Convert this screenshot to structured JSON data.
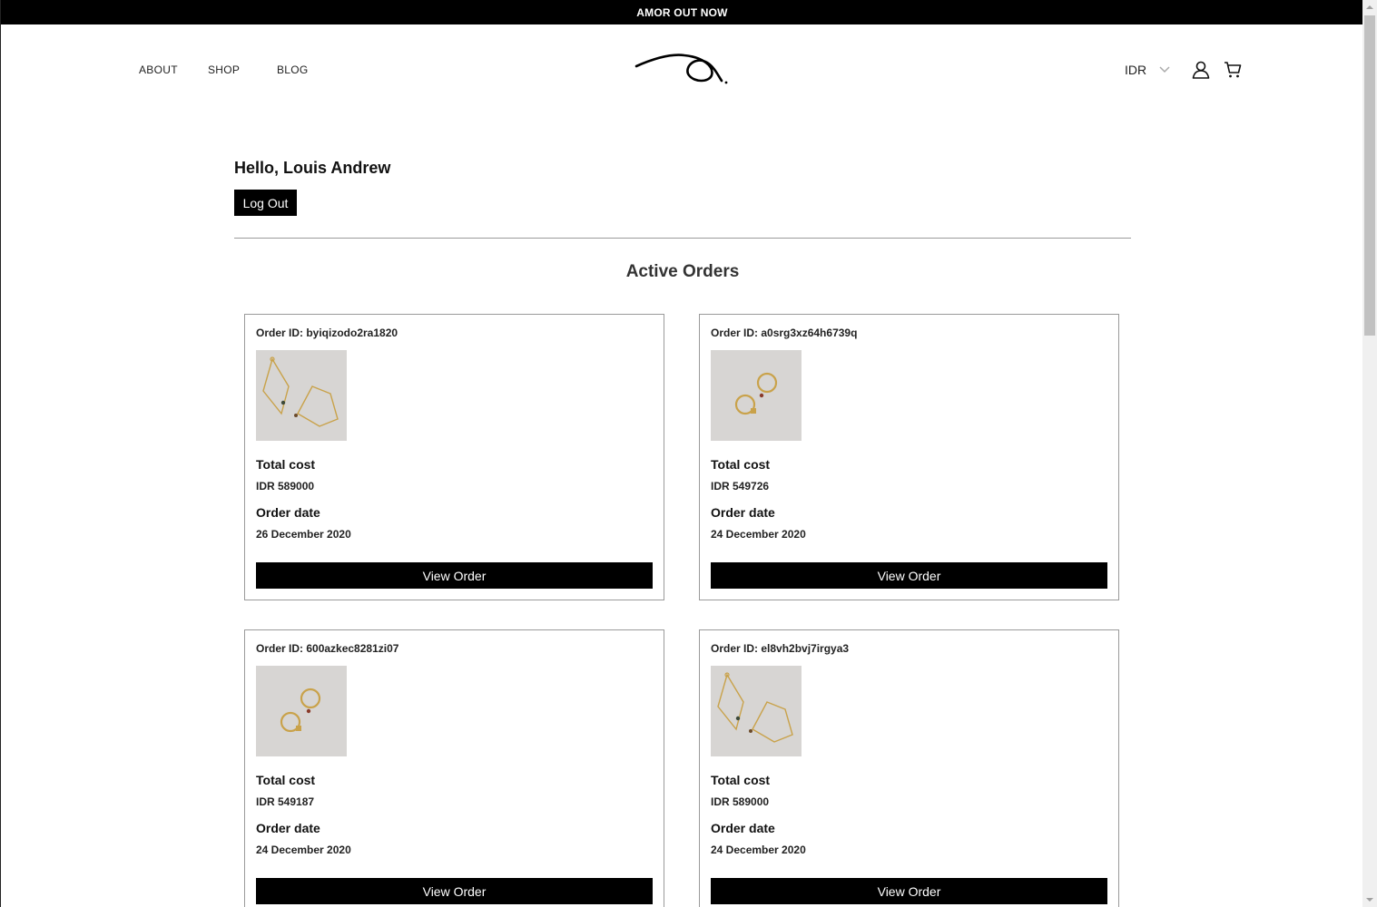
{
  "announcement": "AMOR OUT NOW",
  "nav": {
    "about": "ABOUT",
    "shop": "SHOP",
    "blog": "BLOG"
  },
  "header": {
    "currency": "IDR",
    "logo_icon": "signature-logo-icon",
    "user_icon": "user-icon",
    "cart_icon": "cart-icon"
  },
  "account": {
    "greeting": "Hello, Louis Andrew",
    "logout_label": "Log Out"
  },
  "orders_section": {
    "title": "Active Orders"
  },
  "orders": [
    {
      "id_text": "Order ID: byiqizodo2ra1820",
      "product": "bracelets",
      "cost_label": "Total cost",
      "cost": "IDR 589000",
      "date_label": "Order date",
      "date": "26 December 2020",
      "button": "View Order"
    },
    {
      "id_text": "Order ID: a0srg3xz64h6739q",
      "product": "rings",
      "cost_label": "Total cost",
      "cost": "IDR 549726",
      "date_label": "Order date",
      "date": "24 December 2020",
      "button": "View Order"
    },
    {
      "id_text": "Order ID: 600azkec8281zi07",
      "product": "rings",
      "cost_label": "Total cost",
      "cost": "IDR 549187",
      "date_label": "Order date",
      "date": "24 December 2020",
      "button": "View Order"
    },
    {
      "id_text": "Order ID: el8vh2bvj7irgya3",
      "product": "bracelets",
      "cost_label": "Total cost",
      "cost": "IDR 589000",
      "date_label": "Order date",
      "date": "24 December 2020",
      "button": "View Order"
    }
  ],
  "colors": {
    "bar": "#000000",
    "divider": "#9a9a9a",
    "thumb_bg": "#d7d5d3",
    "gold": "#c9a24a"
  }
}
